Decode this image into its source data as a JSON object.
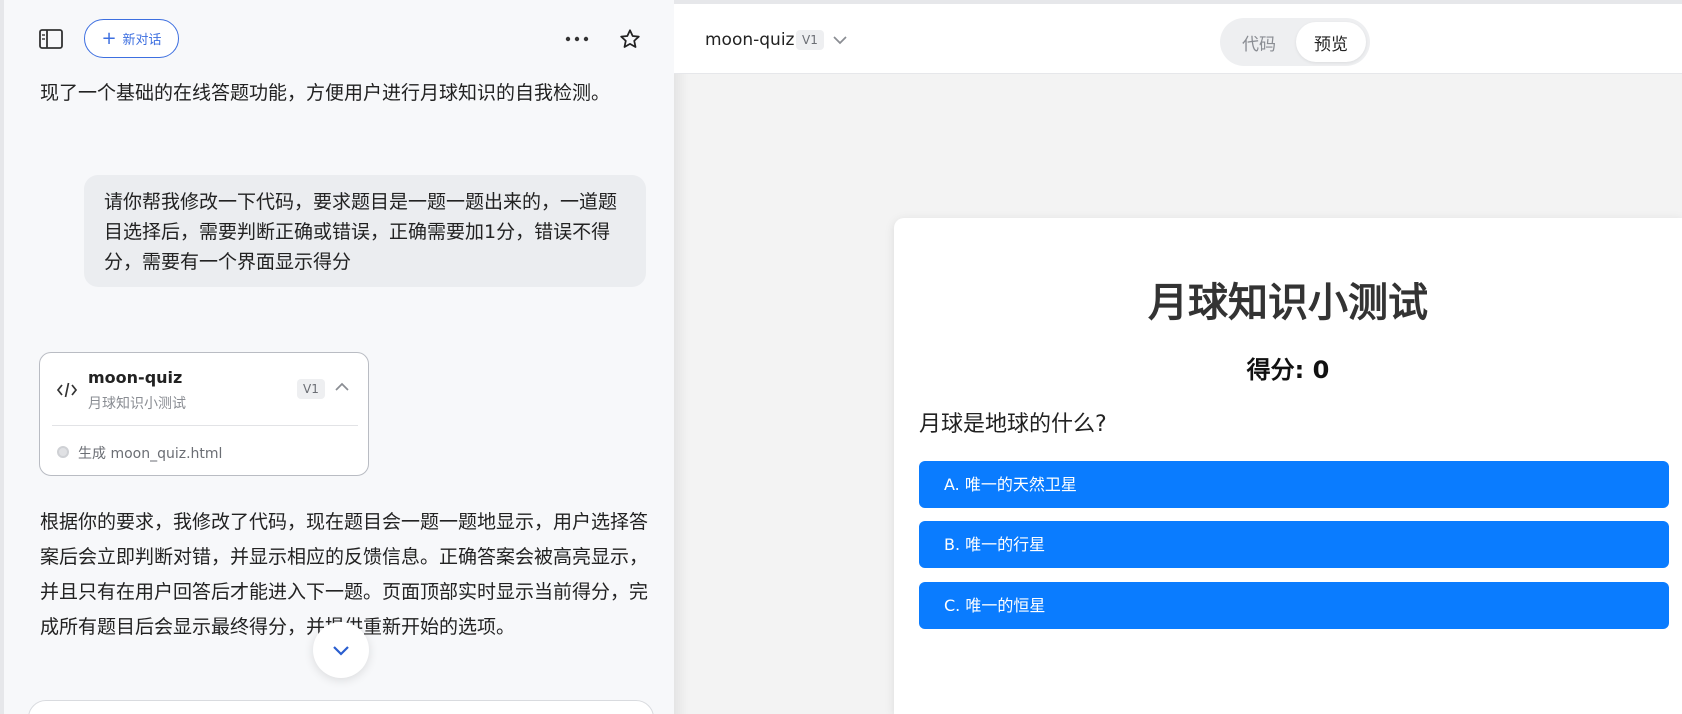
{
  "sidebar": {
    "new_chat_label": "新对话"
  },
  "chat": {
    "assistant_prev_tail": "现了一个基础的在线答题功能，方便用户进行月球知识的自我检测。",
    "user_message": "请你帮我修改一下代码，要求题目是一题一题出来的，一道题目选择后，需要判断正确或错误，正确需要加1分，错误不得分，需要有一个界面显示得分",
    "artifact": {
      "title": "moon-quiz",
      "subtitle": "月球知识小测试",
      "version": "V1",
      "step": "生成 moon_quiz.html"
    },
    "assistant_reply": "根据你的要求，我修改了代码，现在题目会一题一题地显示，用户选择答案后会立即判断对错，并显示相应的反馈信息。正确答案会被高亮显示，并且只有在用户回答后才能进入下一题。页面顶部实时显示当前得分，完成所有题目后会显示最终得分，并提供重新开始的选项。"
  },
  "preview": {
    "file_name": "moon-quiz",
    "version": "V1",
    "tabs": {
      "code": "代码",
      "preview": "预览"
    },
    "accent": "#0a7cff",
    "quiz": {
      "title": "月球知识小测试",
      "score_label": "得分: ",
      "score_value": "0",
      "question": "月球是地球的什么?",
      "options": [
        "A. 唯一的天然卫星",
        "B. 唯一的行星",
        "C. 唯一的恒星"
      ]
    }
  }
}
